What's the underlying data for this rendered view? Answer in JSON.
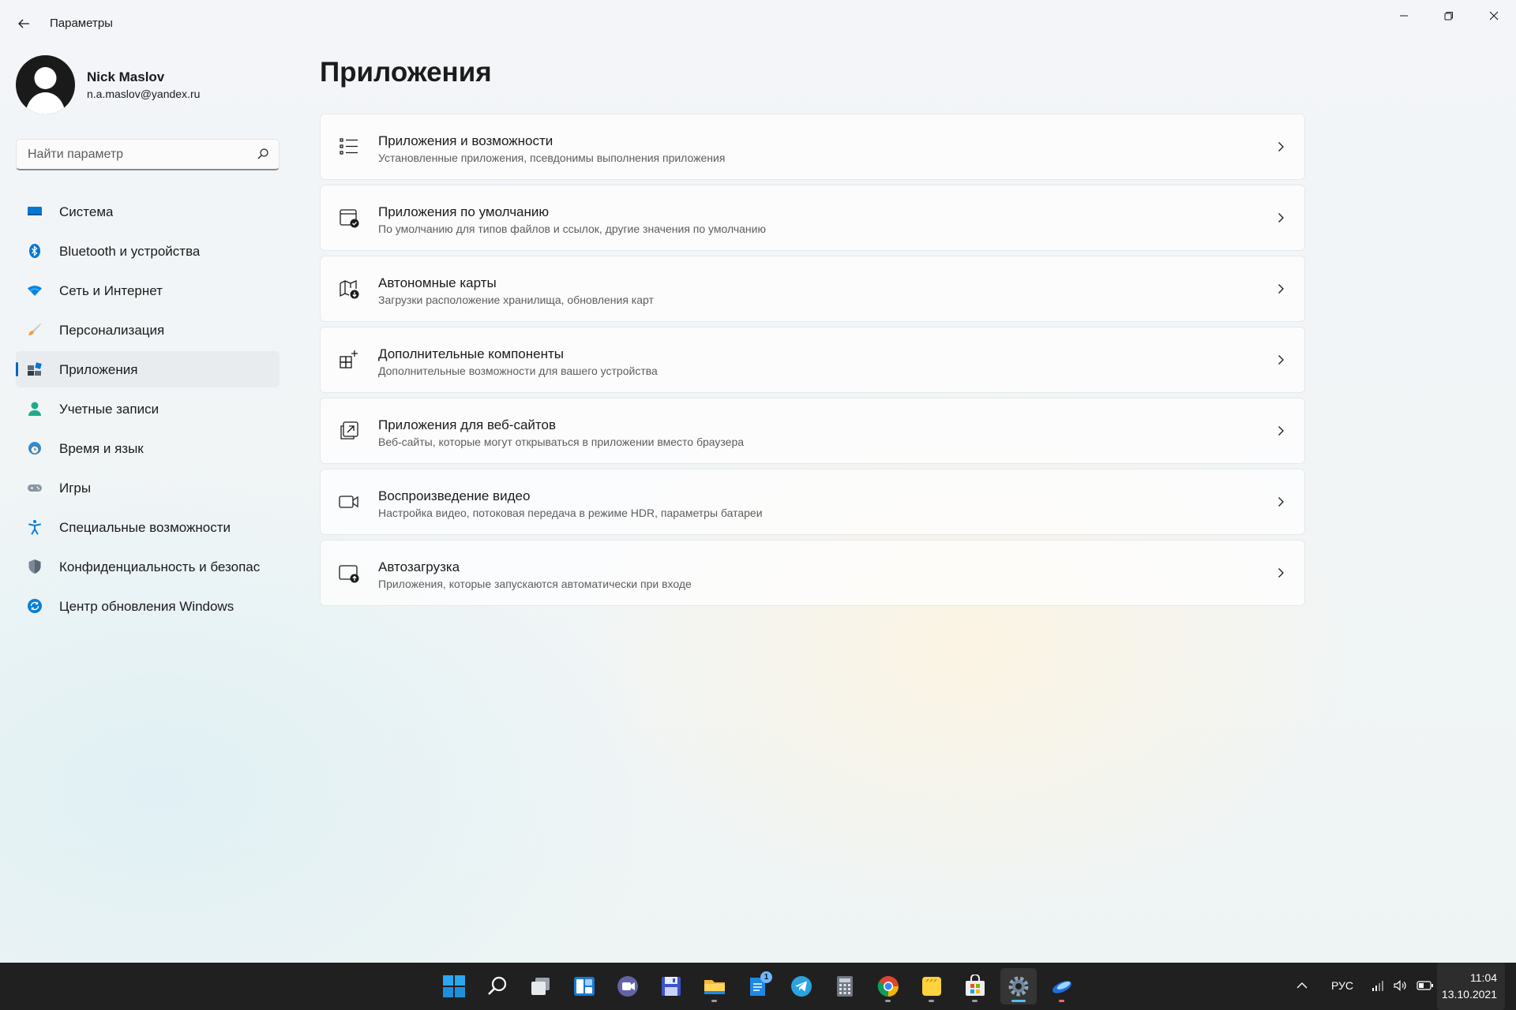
{
  "window": {
    "title": "Параметры",
    "back_icon": "arrow-left-icon",
    "controls": [
      "minimize-icon",
      "restore-icon",
      "close-icon"
    ]
  },
  "profile": {
    "name": "Nick Maslov",
    "email": "n.a.maslov@yandex.ru"
  },
  "search": {
    "placeholder": "Найти параметр",
    "value": ""
  },
  "sidebar": {
    "active_index": 4,
    "items": [
      {
        "label": "Система",
        "icon": "display-icon"
      },
      {
        "label": "Bluetooth и устройства",
        "icon": "bluetooth-icon"
      },
      {
        "label": "Сеть и Интернет",
        "icon": "wifi-icon"
      },
      {
        "label": "Персонализация",
        "icon": "brush-icon"
      },
      {
        "label": "Приложения",
        "icon": "apps-icon"
      },
      {
        "label": "Учетные записи",
        "icon": "person-icon"
      },
      {
        "label": "Время и язык",
        "icon": "globe-clock-icon"
      },
      {
        "label": "Игры",
        "icon": "gamepad-icon"
      },
      {
        "label": "Специальные возможности",
        "icon": "accessibility-icon"
      },
      {
        "label": "Конфиденциальность и безопас",
        "icon": "shield-icon"
      },
      {
        "label": "Центр обновления Windows",
        "icon": "update-icon"
      }
    ]
  },
  "main": {
    "title": "Приложения",
    "cards": [
      {
        "title": "Приложения и возможности",
        "subtitle": "Установленные приложения, псевдонимы выполнения приложения",
        "icon": "list-icon"
      },
      {
        "title": "Приложения по умолчанию",
        "subtitle": "По умолчанию для типов файлов и ссылок, другие значения по умолчанию",
        "icon": "default-apps-icon"
      },
      {
        "title": "Автономные карты",
        "subtitle": "Загрузки расположение хранилища, обновления карт",
        "icon": "offline-map-icon"
      },
      {
        "title": "Дополнительные компоненты",
        "subtitle": "Дополнительные возможности для вашего устройства",
        "icon": "optional-features-icon"
      },
      {
        "title": "Приложения для веб-сайтов",
        "subtitle": "Веб-сайты, которые могут открываться в приложении вместо браузера",
        "icon": "open-external-icon"
      },
      {
        "title": "Воспроизведение видео",
        "subtitle": "Настройка видео, потоковая передача в режиме HDR, параметры батареи",
        "icon": "video-camera-icon"
      },
      {
        "title": "Автозагрузка",
        "subtitle": "Приложения, которые запускаются автоматически при входе",
        "icon": "startup-icon"
      }
    ]
  },
  "taskbar": {
    "apps": [
      {
        "icon": "windows-start-icon"
      },
      {
        "icon": "search-icon"
      },
      {
        "icon": "task-view-icon"
      },
      {
        "icon": "widgets-icon"
      },
      {
        "icon": "teams-chat-icon"
      },
      {
        "icon": "save-disk-icon"
      },
      {
        "icon": "file-explorer-icon",
        "running": true
      },
      {
        "icon": "notes-app-icon",
        "badge": "1"
      },
      {
        "icon": "telegram-icon"
      },
      {
        "icon": "calculator-icon"
      },
      {
        "icon": "chrome-icon",
        "running": true
      },
      {
        "icon": "sticky-notes-icon",
        "running": true
      },
      {
        "icon": "store-icon",
        "running": true
      },
      {
        "icon": "settings-gear-icon",
        "active": true
      },
      {
        "icon": "comet-app-icon",
        "running": true
      }
    ],
    "tray": {
      "language": "РУС",
      "time": "11:04",
      "date": "13.10.2021",
      "icons": [
        "chevron-up-icon",
        "signal-icon",
        "volume-icon",
        "battery-icon"
      ]
    }
  },
  "colors": {
    "accent": "#0067c0",
    "taskbar": "#202020",
    "active_indicator": "#4cc2ff"
  }
}
